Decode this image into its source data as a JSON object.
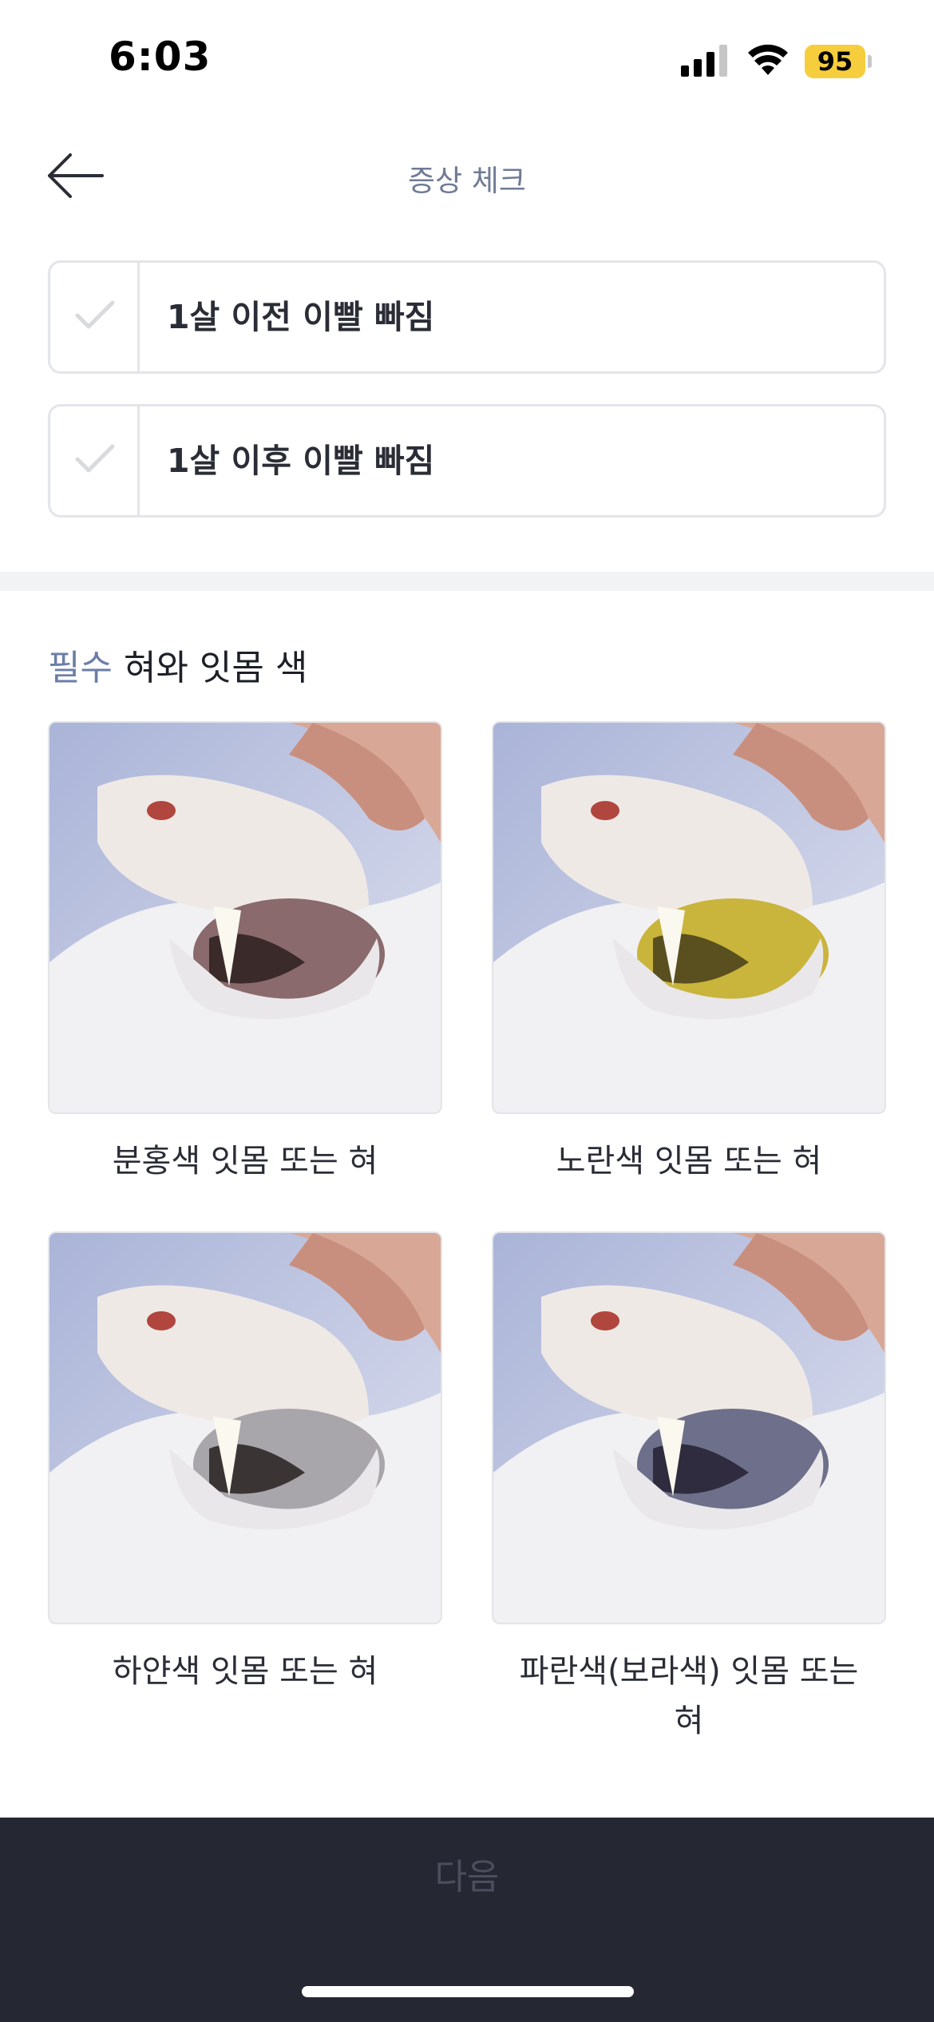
{
  "status_bar": {
    "time": "6:03",
    "battery": "95",
    "battery_color": "#f6cd3c"
  },
  "header": {
    "title": "증상 체크",
    "back_icon": "arrow-left-icon"
  },
  "checks": [
    {
      "label": "1살 이전 이빨 빠짐",
      "icon": "check-icon",
      "checked": false
    },
    {
      "label": "1살 이후 이빨 빠짐",
      "icon": "check-icon",
      "checked": false
    }
  ],
  "section": {
    "required_tag": "필수",
    "title": "혀와 잇몸 색",
    "required_color": "#6b7ea8"
  },
  "options": [
    {
      "label": "분홍색 잇몸 또는 혀",
      "gum_color": "#8a6a6c"
    },
    {
      "label": "노란색 잇몸 또는 혀",
      "gum_color": "#c9b43c"
    },
    {
      "label": "하얀색 잇몸 또는 혀",
      "gum_color": "#a8a6aa"
    },
    {
      "label": "파란색(보라색) 잇몸 또는 혀",
      "gum_color": "#6e6f8a"
    }
  ],
  "footer": {
    "next_label": "다음"
  }
}
